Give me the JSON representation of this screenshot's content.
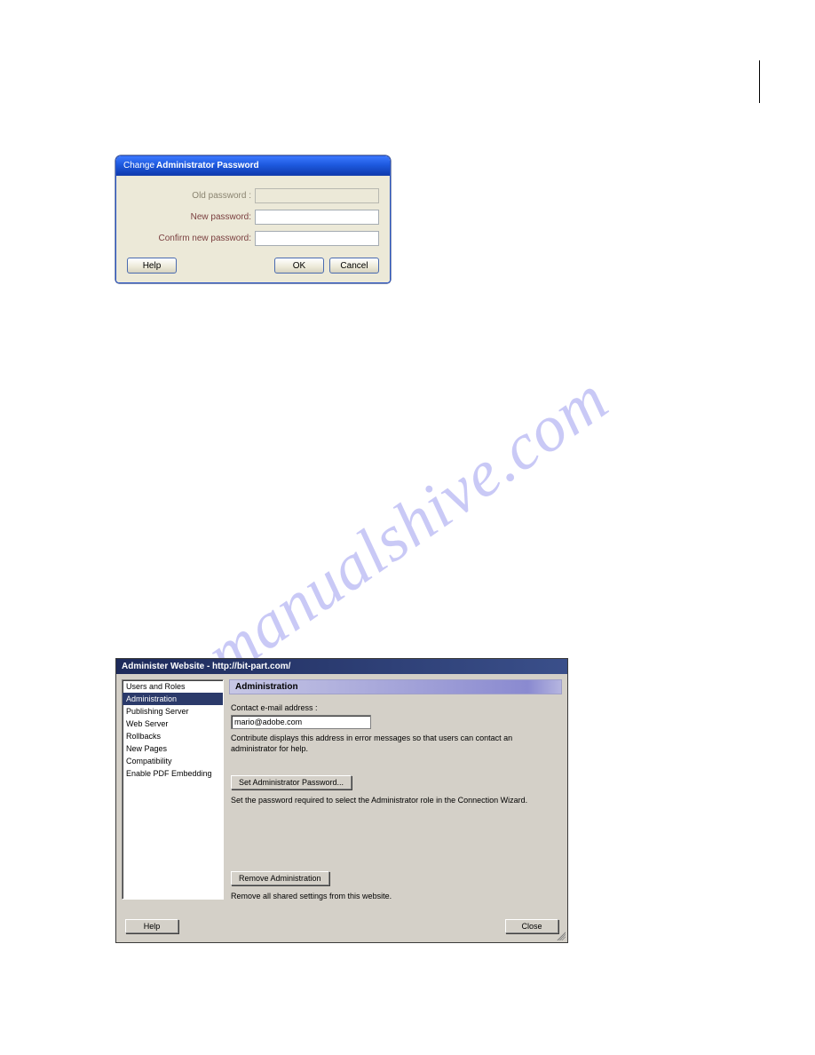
{
  "watermark": "manualshive.com",
  "dialog1": {
    "title_prefix": "Change",
    "title_bold": "Administrator Password",
    "old_password_label": "Old password :",
    "new_password_label": "New password:",
    "confirm_password_label": "Confirm new password:",
    "help_label": "Help",
    "ok_label": "OK",
    "cancel_label": "Cancel"
  },
  "dialog2": {
    "title": "Administer Website - http://bit-part.com/",
    "sidebar": {
      "items": [
        {
          "label": "Users and Roles"
        },
        {
          "label": "Administration"
        },
        {
          "label": "Publishing Server"
        },
        {
          "label": "Web Server"
        },
        {
          "label": "Rollbacks"
        },
        {
          "label": "New Pages"
        },
        {
          "label": "Compatibility"
        },
        {
          "label": "Enable PDF Embedding"
        }
      ],
      "selected_index": 1
    },
    "panel": {
      "header": "Administration",
      "contact_label": "Contact e-mail address :",
      "contact_value": "mario@adobe.com",
      "contact_desc": "Contribute displays this address in error messages so that users can contact an administrator for help.",
      "set_password_button": "Set Administrator Password...",
      "set_password_desc": "Set the password required to select the Administrator role in the Connection Wizard.",
      "remove_button": "Remove Administration",
      "remove_desc": "Remove all shared settings from this website."
    },
    "footer": {
      "help_label": "Help",
      "close_label": "Close"
    }
  }
}
